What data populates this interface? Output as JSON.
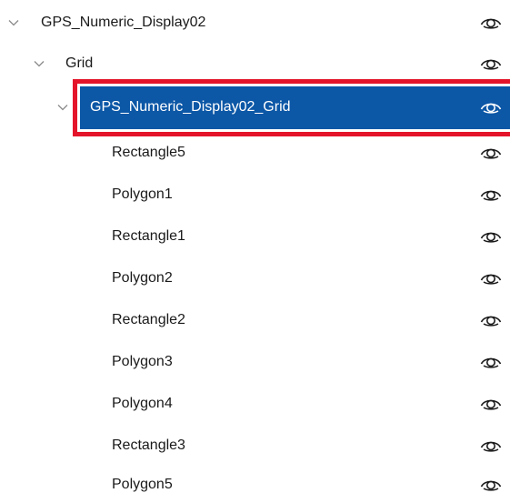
{
  "tree": {
    "root": {
      "label": "GPS_Numeric_Display02",
      "expanded": true,
      "visibility_icon": "eye-icon"
    },
    "group": {
      "label": "Grid",
      "expanded": true,
      "visibility_icon": "eye-icon"
    },
    "selected_node": {
      "label": "GPS_Numeric_Display02_Grid",
      "expanded": true,
      "selected": true,
      "visibility_icon": "eye-icon"
    },
    "children": [
      {
        "label": "Rectangle5",
        "visibility_icon": "eye-icon"
      },
      {
        "label": "Polygon1",
        "visibility_icon": "eye-icon"
      },
      {
        "label": "Rectangle1",
        "visibility_icon": "eye-icon"
      },
      {
        "label": "Polygon2",
        "visibility_icon": "eye-icon"
      },
      {
        "label": "Rectangle2",
        "visibility_icon": "eye-icon"
      },
      {
        "label": "Polygon3",
        "visibility_icon": "eye-icon"
      },
      {
        "label": "Polygon4",
        "visibility_icon": "eye-icon"
      },
      {
        "label": "Rectangle3",
        "visibility_icon": "eye-icon"
      },
      {
        "label": "Polygon5",
        "visibility_icon": "eye-icon"
      }
    ]
  },
  "colors": {
    "selection_fill": "#0c57a6",
    "highlight_outline": "#e4152a",
    "text": "#1a1a1a",
    "chevron": "#8a8a8a"
  }
}
